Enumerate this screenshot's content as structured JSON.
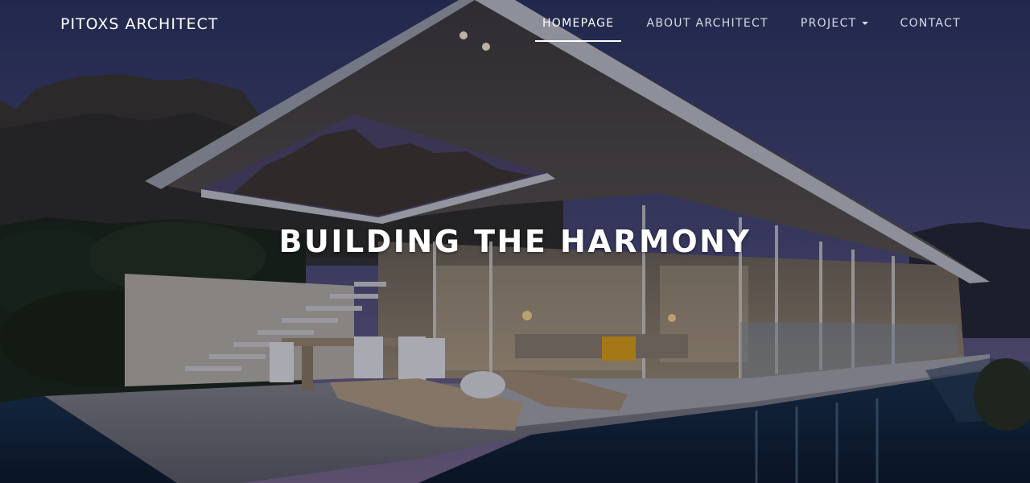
{
  "brand": {
    "name": "PITOXS ARCHITECT"
  },
  "nav": {
    "items": [
      {
        "label": "HOMEPAGE",
        "active": true
      },
      {
        "label": "ABOUT ARCHITECT",
        "active": false
      },
      {
        "label": "PROJECT",
        "active": false,
        "dropdown": true
      },
      {
        "label": "CONTACT",
        "active": false
      }
    ]
  },
  "hero": {
    "headline": "BUILDING THE HARMONY",
    "background_image": "modern glass villa with cantilevered roof beside infinity pool, mountains at dusk"
  },
  "colors": {
    "sky_top": "#2c3560",
    "sky_bottom": "#6a5f86",
    "text": "#ffffff",
    "nav_text": "#d9dbe6"
  }
}
